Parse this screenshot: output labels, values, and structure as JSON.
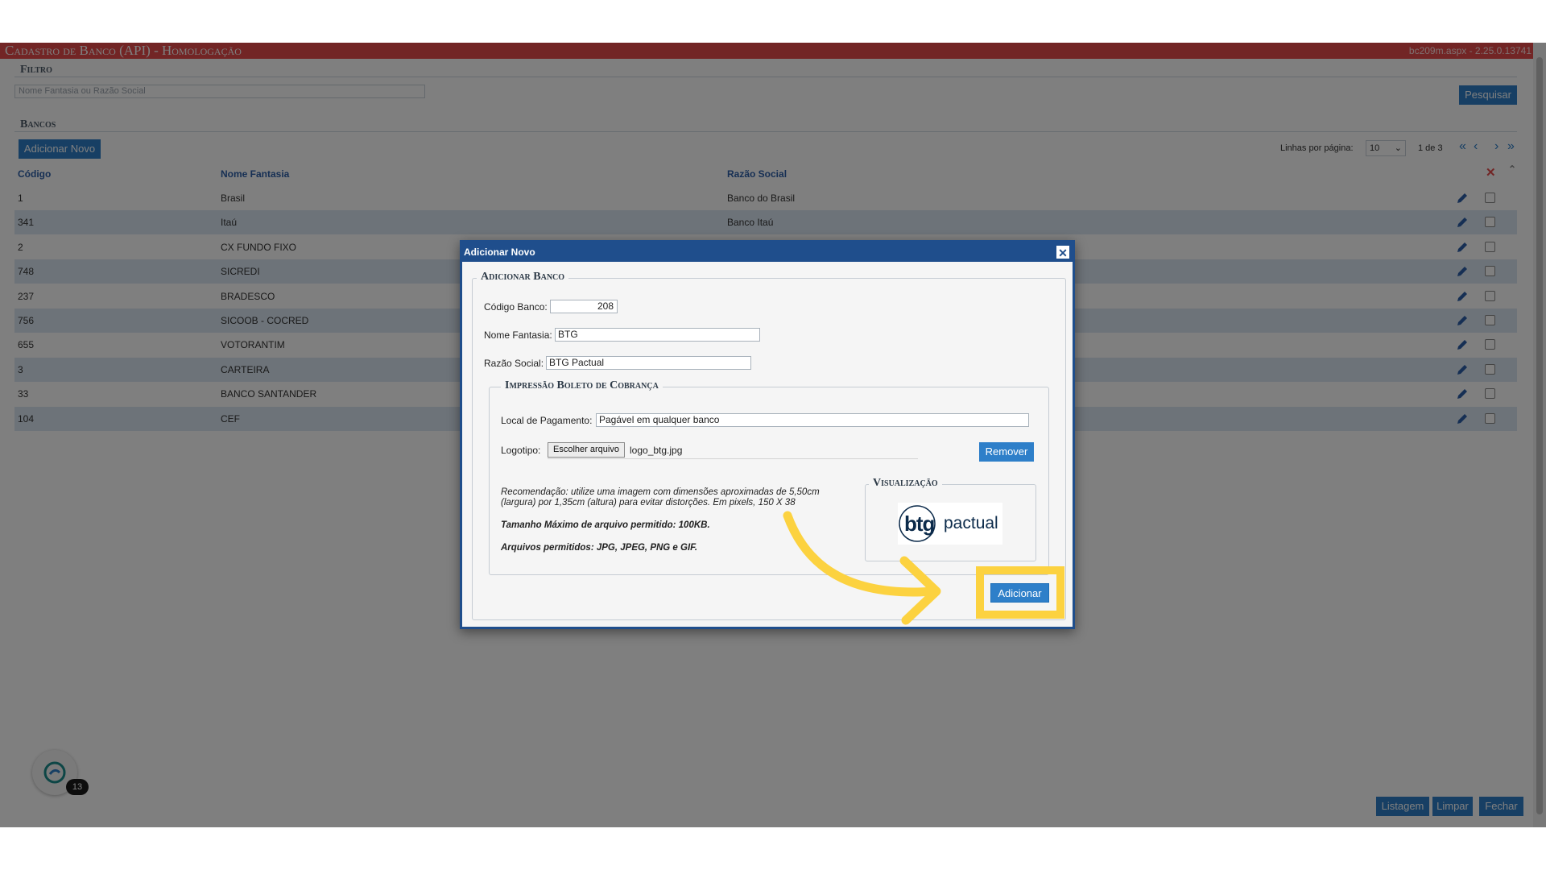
{
  "app": {
    "title": "Cadastro de Banco (API)  - Homologação",
    "version": "bc209m.aspx - 2.25.0.13741"
  },
  "filter": {
    "title": "Filtro",
    "placeholder": "Nome Fantasia ou Razão Social",
    "search_label": "Pesquisar"
  },
  "banks": {
    "title": "Bancos",
    "add_new_label": "Adicionar Novo",
    "rows_per_page_label": "Linhas por página:",
    "rows_per_page_value": "10",
    "page_info": "1 de 3",
    "columns": [
      "Código",
      "Nome Fantasia",
      "Razão Social"
    ],
    "rows": [
      {
        "codigo": "1",
        "nome": "Brasil",
        "razao": "Banco do Brasil"
      },
      {
        "codigo": "341",
        "nome": "Itaú",
        "razao": "Banco Itaú"
      },
      {
        "codigo": "2",
        "nome": "CX FUNDO FIXO",
        "razao": ""
      },
      {
        "codigo": "748",
        "nome": "SICREDI",
        "razao": ""
      },
      {
        "codigo": "237",
        "nome": "BRADESCO",
        "razao": ""
      },
      {
        "codigo": "756",
        "nome": "SICOOB - COCRED",
        "razao": ""
      },
      {
        "codigo": "655",
        "nome": "VOTORANTIM",
        "razao": ""
      },
      {
        "codigo": "3",
        "nome": "CARTEIRA",
        "razao": ""
      },
      {
        "codigo": "33",
        "nome": "BANCO SANTANDER",
        "razao": ""
      },
      {
        "codigo": "104",
        "nome": "CEF",
        "razao": ""
      }
    ]
  },
  "footer": {
    "listagem": "Listagem",
    "limpar": "Limpar",
    "fechar": "Fechar",
    "badge_count": "13"
  },
  "modal": {
    "title": "Adicionar Novo",
    "section_title": "Adicionar Banco",
    "codigo_label": "Código Banco:",
    "codigo_value": "208",
    "nome_label": "Nome Fantasia:",
    "nome_value": "BTG",
    "razao_label": "Razão Social:",
    "razao_value": "BTG Pactual",
    "boleto_title": "Impressão Boleto de Cobrança",
    "local_label": "Local de Pagamento:",
    "local_value": "Pagável em qualquer banco",
    "logotipo_label": "Logotipo:",
    "file_button": "Escolher arquivo",
    "file_name": "logo_btg.jpg",
    "remover_label": "Remover",
    "recomendacao_1": "Recomendação: utilize uma imagem com dimensões aproximadas de 5,50cm",
    "recomendacao_2": "(largura) por 1,35cm (altura) para evitar distorções. Em pixels, 150 X 38",
    "tamanho_max": "Tamanho Máximo de arquivo permitido: 100KB.",
    "arquivos_permitidos": "Arquivos permitidos: JPG, JPEG, PNG e GIF.",
    "visualizacao_title": "Visualização",
    "logo_text_bold": "btg",
    "logo_text_light": "pactual",
    "adicionar_label": "Adicionar"
  },
  "colors": {
    "accent": "#2e7fc9",
    "header_bar": "#e44b4b",
    "modal_header": "#1f4e8c",
    "highlight": "#fcd240"
  }
}
